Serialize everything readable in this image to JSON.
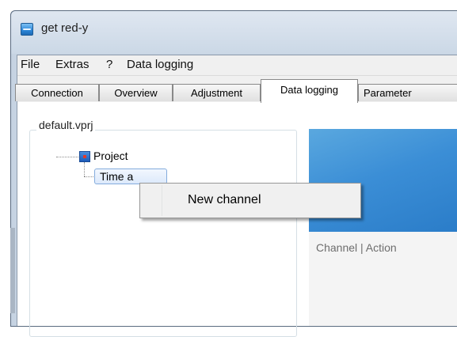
{
  "window": {
    "title": "get red-y"
  },
  "menu": [
    "File",
    "Extras",
    "?",
    "Data logging"
  ],
  "tabs": [
    {
      "label": "Connection",
      "active": false
    },
    {
      "label": "Overview",
      "active": false
    },
    {
      "label": "Adjustment",
      "active": false
    },
    {
      "label": "Data logging",
      "active": true
    },
    {
      "label": "Parameter",
      "active": false
    }
  ],
  "group": {
    "title": "default.vprj"
  },
  "tree": {
    "root": "Project",
    "child": "Time a"
  },
  "panel": {
    "header": "Channel | Action"
  },
  "context_menu": {
    "items": [
      "New channel"
    ]
  }
}
